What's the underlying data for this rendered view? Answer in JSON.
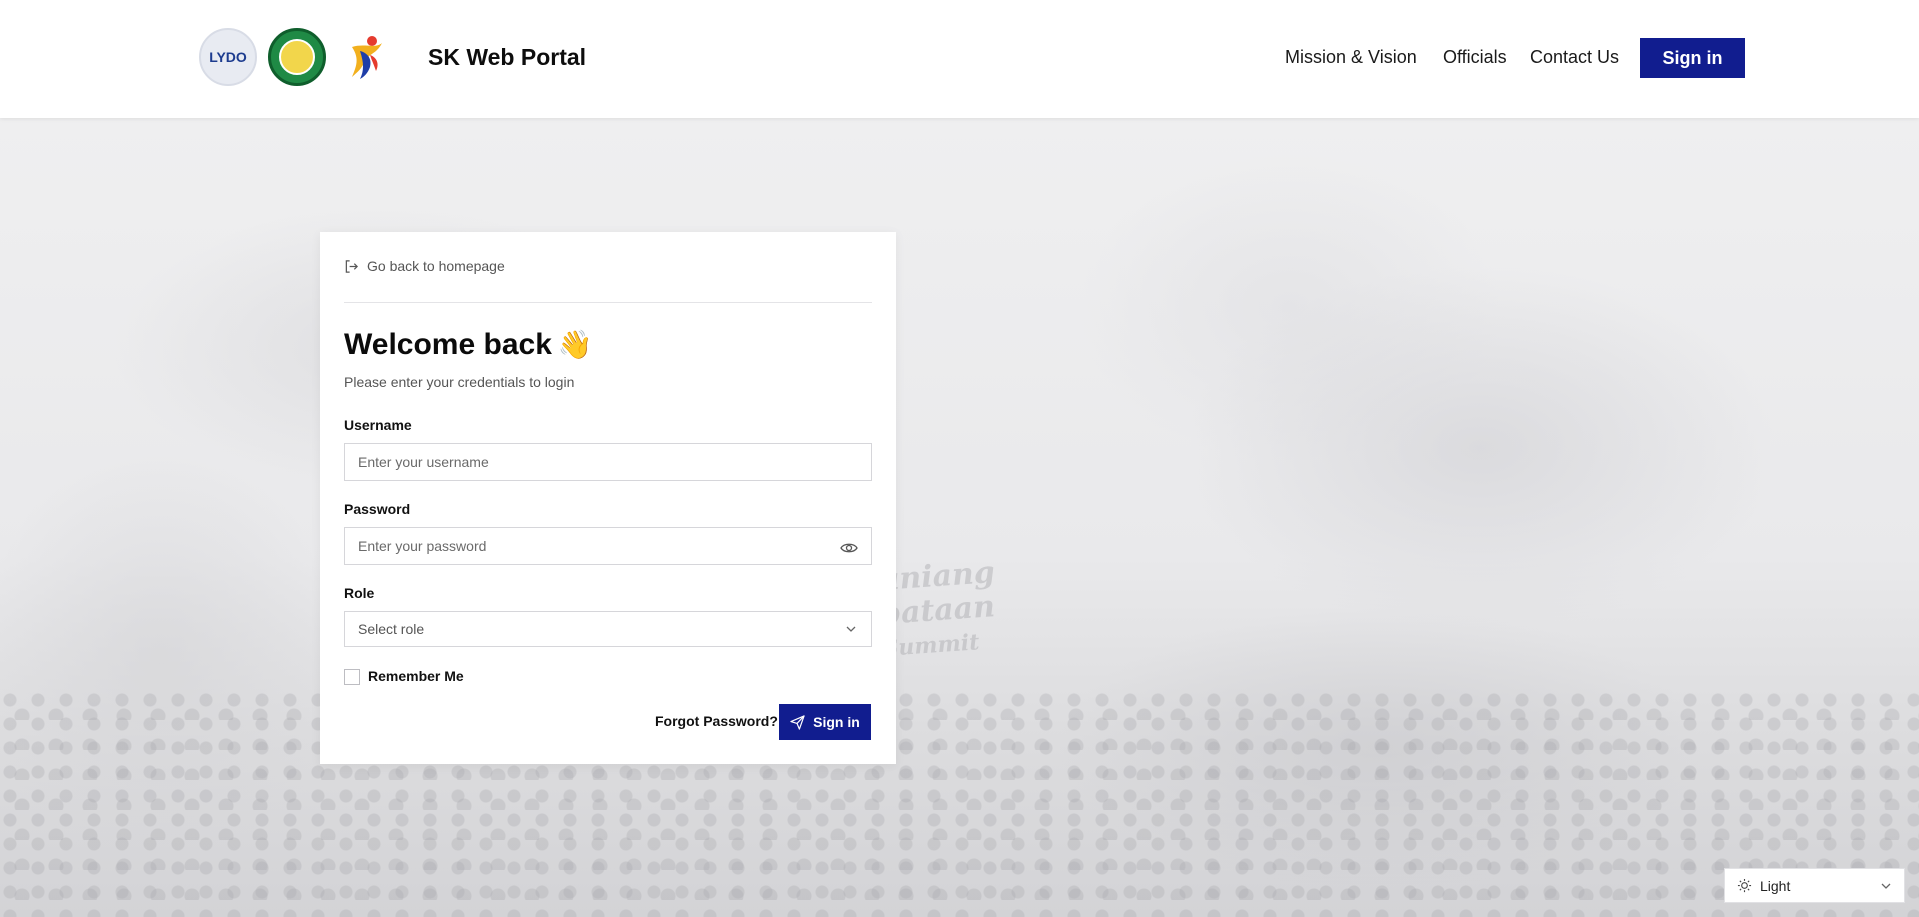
{
  "header": {
    "brand": "SK Web Portal",
    "logos": [
      {
        "name": "LYDO",
        "text": "LYDO"
      },
      {
        "name": "city-seal",
        "text": ""
      },
      {
        "name": "sk-logo",
        "text": ""
      }
    ],
    "nav": [
      "Mission & Vision",
      "Officials",
      "Contact Us"
    ],
    "signin_label": "Sign in",
    "accent": "#111d8f"
  },
  "card": {
    "back_link": "Go back to homepage",
    "title": "Welcome back",
    "wave_emoji": "👋",
    "subtitle": "Please enter your credentials to login",
    "username": {
      "label": "Username",
      "placeholder": "Enter your username",
      "value": ""
    },
    "password": {
      "label": "Password",
      "placeholder": "Enter your password",
      "value": ""
    },
    "role": {
      "label": "Role",
      "placeholder": "Select role"
    },
    "remember_label": "Remember Me",
    "forgot_label": "Forgot Password?",
    "signin_label": "Sign in"
  },
  "background": {
    "watermark_lines": [
      "uniang",
      "bataan",
      "Summit"
    ]
  },
  "theme_selector": {
    "value": "Light"
  }
}
